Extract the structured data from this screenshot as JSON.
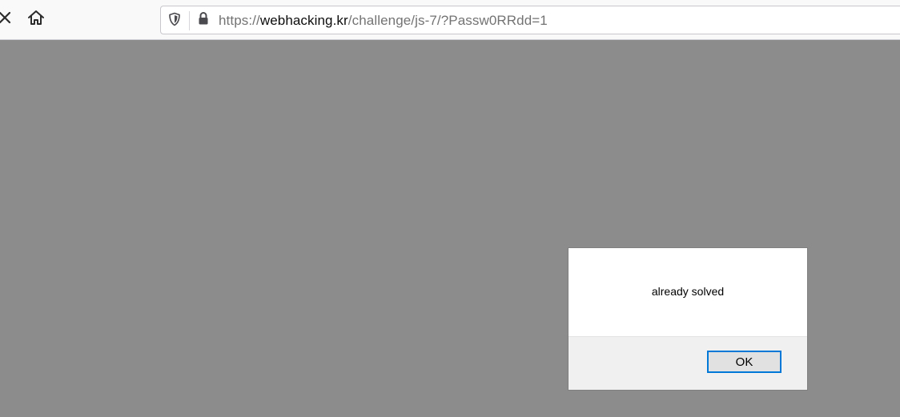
{
  "browser": {
    "url": {
      "scheme": "https://",
      "host": "webhacking.kr",
      "path": "/challenge/js-7/?Passw0RRdd=1"
    },
    "icons": {
      "stop": "close-icon",
      "home": "home-icon",
      "tracking": "shield-icon",
      "secure": "lock-icon"
    }
  },
  "dialog": {
    "message": "already solved",
    "ok_label": "OK"
  },
  "colors": {
    "page_overlay": "#8c8c8c",
    "button_focus": "#0078d7"
  }
}
